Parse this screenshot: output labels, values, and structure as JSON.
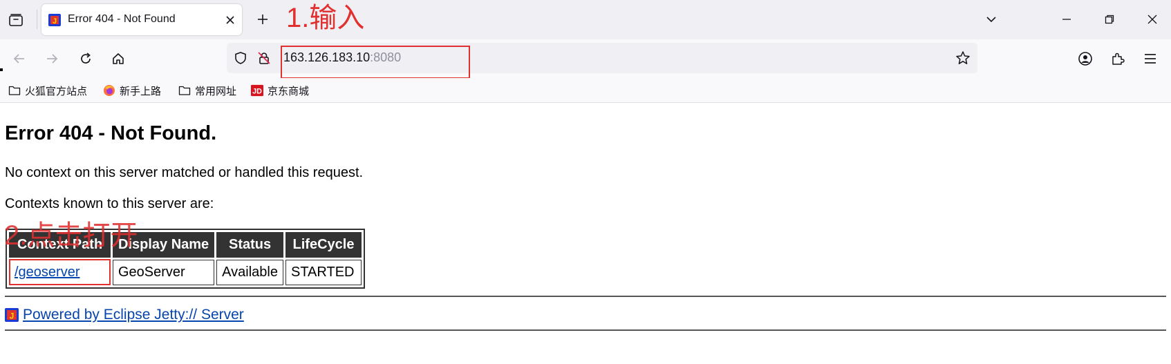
{
  "tab": {
    "title": "Error 404 - Not Found"
  },
  "annotations": {
    "step1": "1.输入",
    "step2": "2.点击打开"
  },
  "address_bar": {
    "host": "163.126.183.10",
    "port": ":8080"
  },
  "bookmarks": [
    {
      "label": "火狐官方站点",
      "icon": "folder-icon"
    },
    {
      "label": "新手上路",
      "icon": "firefox-icon"
    },
    {
      "label": "常用网址",
      "icon": "folder-icon"
    },
    {
      "label": "京东商城",
      "icon": "jd-icon"
    }
  ],
  "page": {
    "heading": "Error 404 - Not Found.",
    "message": "No context on this server matched or handled this request.",
    "contexts_intro": "Contexts known to this server are:",
    "table": {
      "headers": [
        "Context Path",
        "Display Name",
        "Status",
        "LifeCycle"
      ],
      "rows": [
        [
          "/geoserver",
          "GeoServer",
          "Available",
          "STARTED"
        ]
      ]
    },
    "footer_link": "Powered by Eclipse Jetty:// Server"
  },
  "colors": {
    "annotation": "#e03030",
    "link": "#0645ad",
    "table_header_bg": "#333333"
  }
}
